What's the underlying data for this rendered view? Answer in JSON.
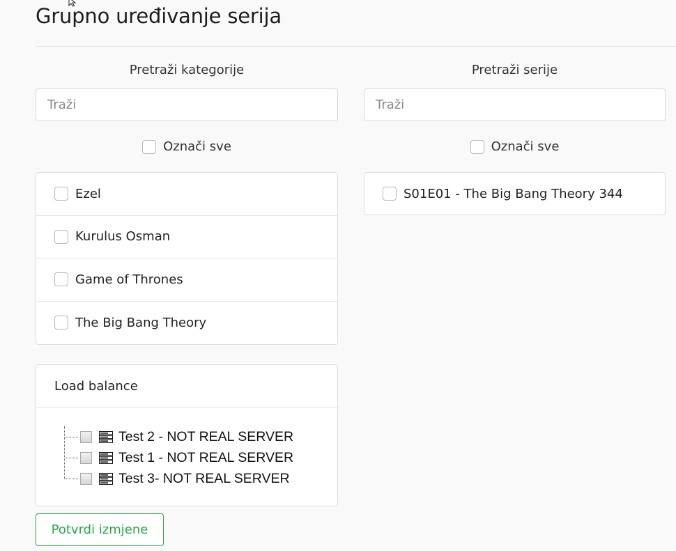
{
  "page": {
    "title": "Grupno uređivanje serija"
  },
  "categories": {
    "label": "Pretraži kategorije",
    "search_placeholder": "Traži",
    "check_all_label": "Označi sve",
    "items": [
      {
        "label": "Ezel",
        "checked": false
      },
      {
        "label": "Kurulus Osman",
        "checked": false
      },
      {
        "label": "Game of Thrones",
        "checked": false
      },
      {
        "label": "The Big Bang Theory",
        "checked": false
      }
    ]
  },
  "series": {
    "label": "Pretraži serije",
    "search_placeholder": "Traži",
    "check_all_label": "Označi sve",
    "items": [
      {
        "label": "S01E01 - The Big Bang Theory 344",
        "checked": false
      }
    ]
  },
  "load_balance": {
    "title": "Load balance",
    "servers": [
      {
        "label": "Test 2 - NOT REAL SERVER",
        "icon": "server-icon"
      },
      {
        "label": "Test 1 - NOT REAL SERVER",
        "icon": "server-icon"
      },
      {
        "label": "Test 3- NOT REAL SERVER",
        "icon": "server-icon"
      }
    ]
  },
  "actions": {
    "confirm_label": "Potvrdi izmjene"
  },
  "colors": {
    "accent_green": "#28a745",
    "background": "#f9f9f9",
    "border": "#dedede"
  }
}
